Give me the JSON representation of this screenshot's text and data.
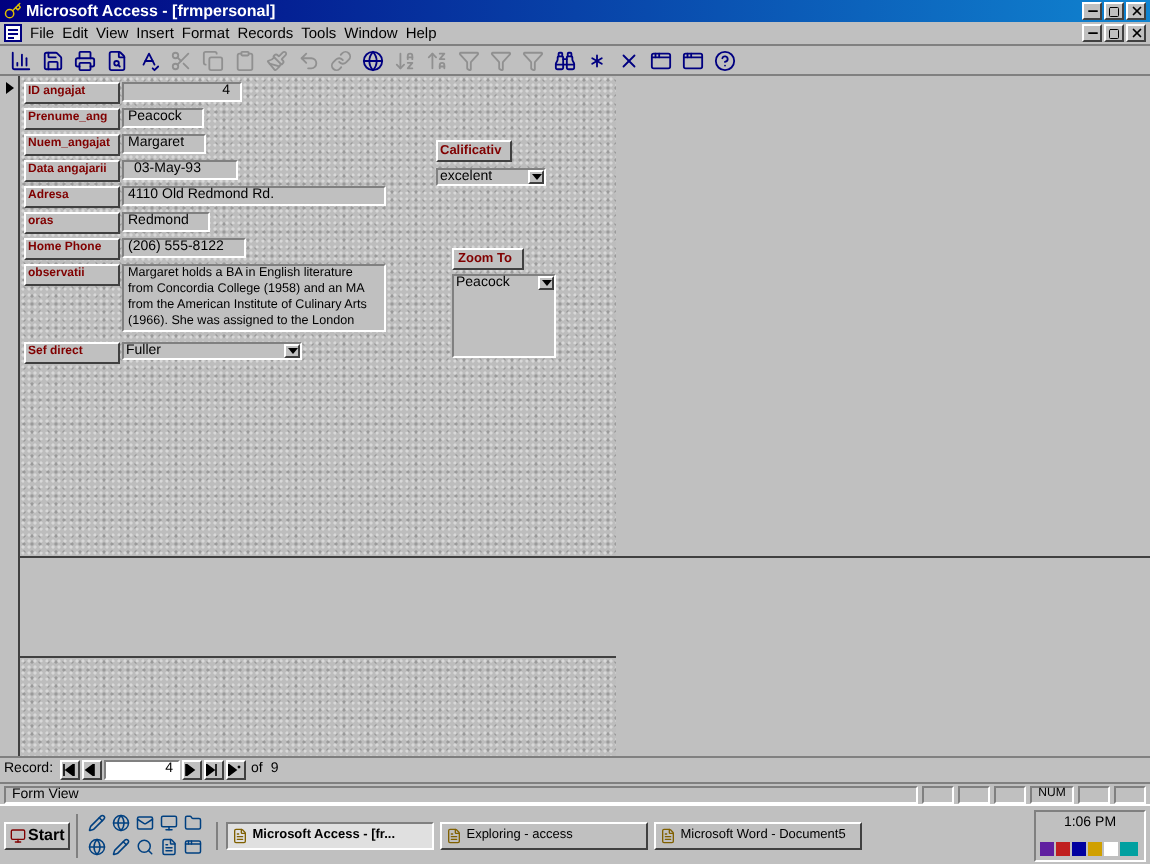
{
  "window": {
    "title": "Microsoft Access - [frmpersonal]"
  },
  "menu": [
    "File",
    "Edit",
    "View",
    "Insert",
    "Format",
    "Records",
    "Tools",
    "Window",
    "Help"
  ],
  "form": {
    "fields": [
      {
        "label": "ID angajat",
        "value": "4",
        "kind": "number"
      },
      {
        "label": "Prenume_ang",
        "value": "Peacock",
        "kind": "text"
      },
      {
        "label": "Nuem_angajat",
        "value": "Margaret",
        "kind": "text"
      },
      {
        "label": "Data angajarii",
        "value": "03-May-93",
        "kind": "date"
      },
      {
        "label": "Adresa",
        "value": "4110 Old Redmond Rd.",
        "kind": "wide"
      },
      {
        "label": "oras",
        "value": "Redmond",
        "kind": "text"
      },
      {
        "label": "Home Phone",
        "value": "(206) 555-8122",
        "kind": "text"
      },
      {
        "label": "observatii",
        "value": "Margaret holds a BA in English literature from Concordia College (1958) and an MA from the American Institute of Culinary Arts (1966).  She was assigned to the London",
        "kind": "memo"
      },
      {
        "label": "Sef direct",
        "value": "Fuller",
        "kind": "combo"
      }
    ],
    "calificativ": {
      "label": "Calificativ",
      "value": "excelent"
    },
    "zoom_to": {
      "label": "Zoom To",
      "value": "Peacock"
    }
  },
  "record_nav": {
    "label": "Record:",
    "current": "4",
    "of": "of",
    "total": "9"
  },
  "status_bar": {
    "text": "Form View",
    "indicator": "NUM"
  },
  "taskbar": {
    "start": "Start",
    "tasks": [
      {
        "label": "Microsoft Access - [fr...",
        "selected": true
      },
      {
        "label": "Exploring - access",
        "selected": false
      },
      {
        "label": "Microsoft Word - Document5",
        "selected": false
      }
    ],
    "clock": "1:06 PM"
  }
}
